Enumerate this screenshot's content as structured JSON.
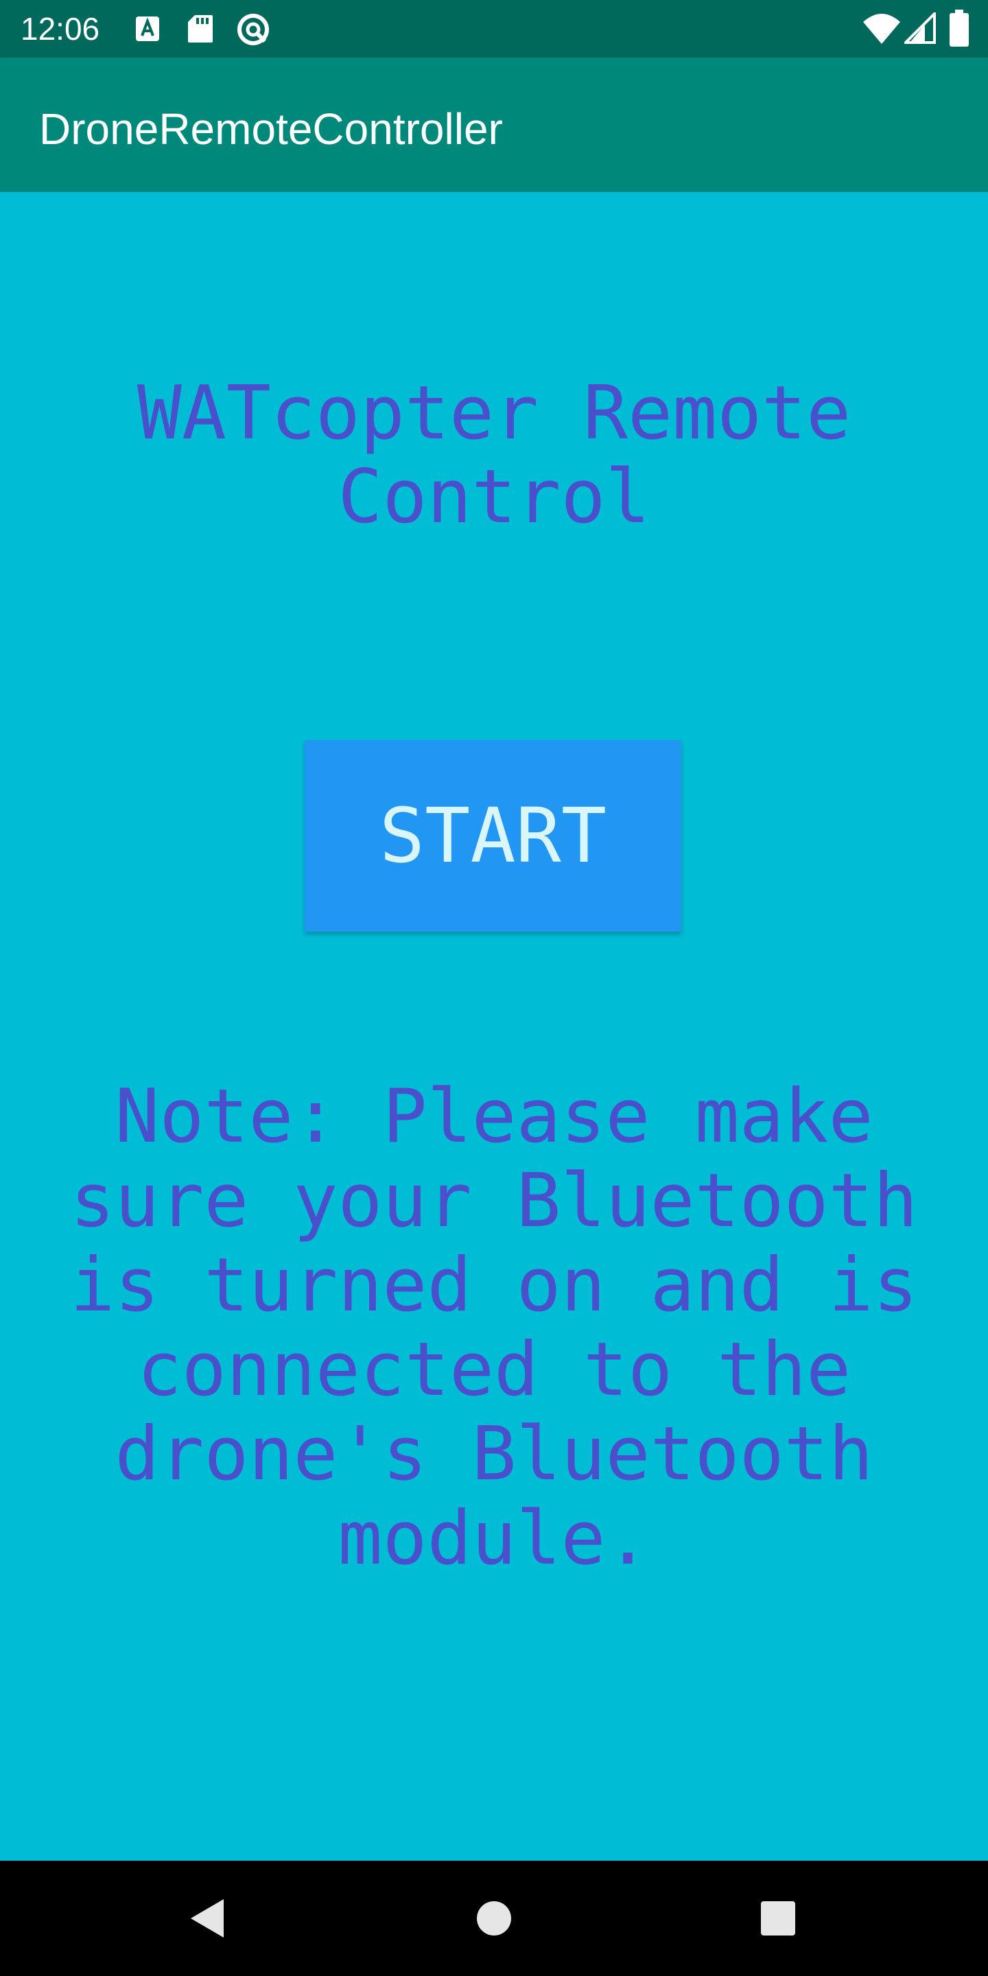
{
  "status_bar": {
    "time": "12:06",
    "left_icons": [
      "font-icon",
      "sd-card-icon",
      "sync-icon"
    ],
    "right_icons": [
      "wifi-icon",
      "cellular-signal-icon",
      "battery-icon"
    ]
  },
  "app_bar": {
    "title": "DroneRemoteController"
  },
  "main": {
    "heading": "WATcopter Remote\nControl",
    "start_button_label": "START",
    "note": "Note: Please make sure your Bluetooth is turned on and is connected to the drone's Bluetooth module."
  },
  "nav_bar": {
    "buttons": [
      "back-icon",
      "home-icon",
      "recents-icon"
    ]
  },
  "colors": {
    "status_bar": "#00695C",
    "app_bar": "#00897B",
    "background": "#00BCD4",
    "text": "#4A4FCB",
    "button": "#2196F3",
    "button_text": "#D9F7FA",
    "nav_bar": "#000000"
  }
}
